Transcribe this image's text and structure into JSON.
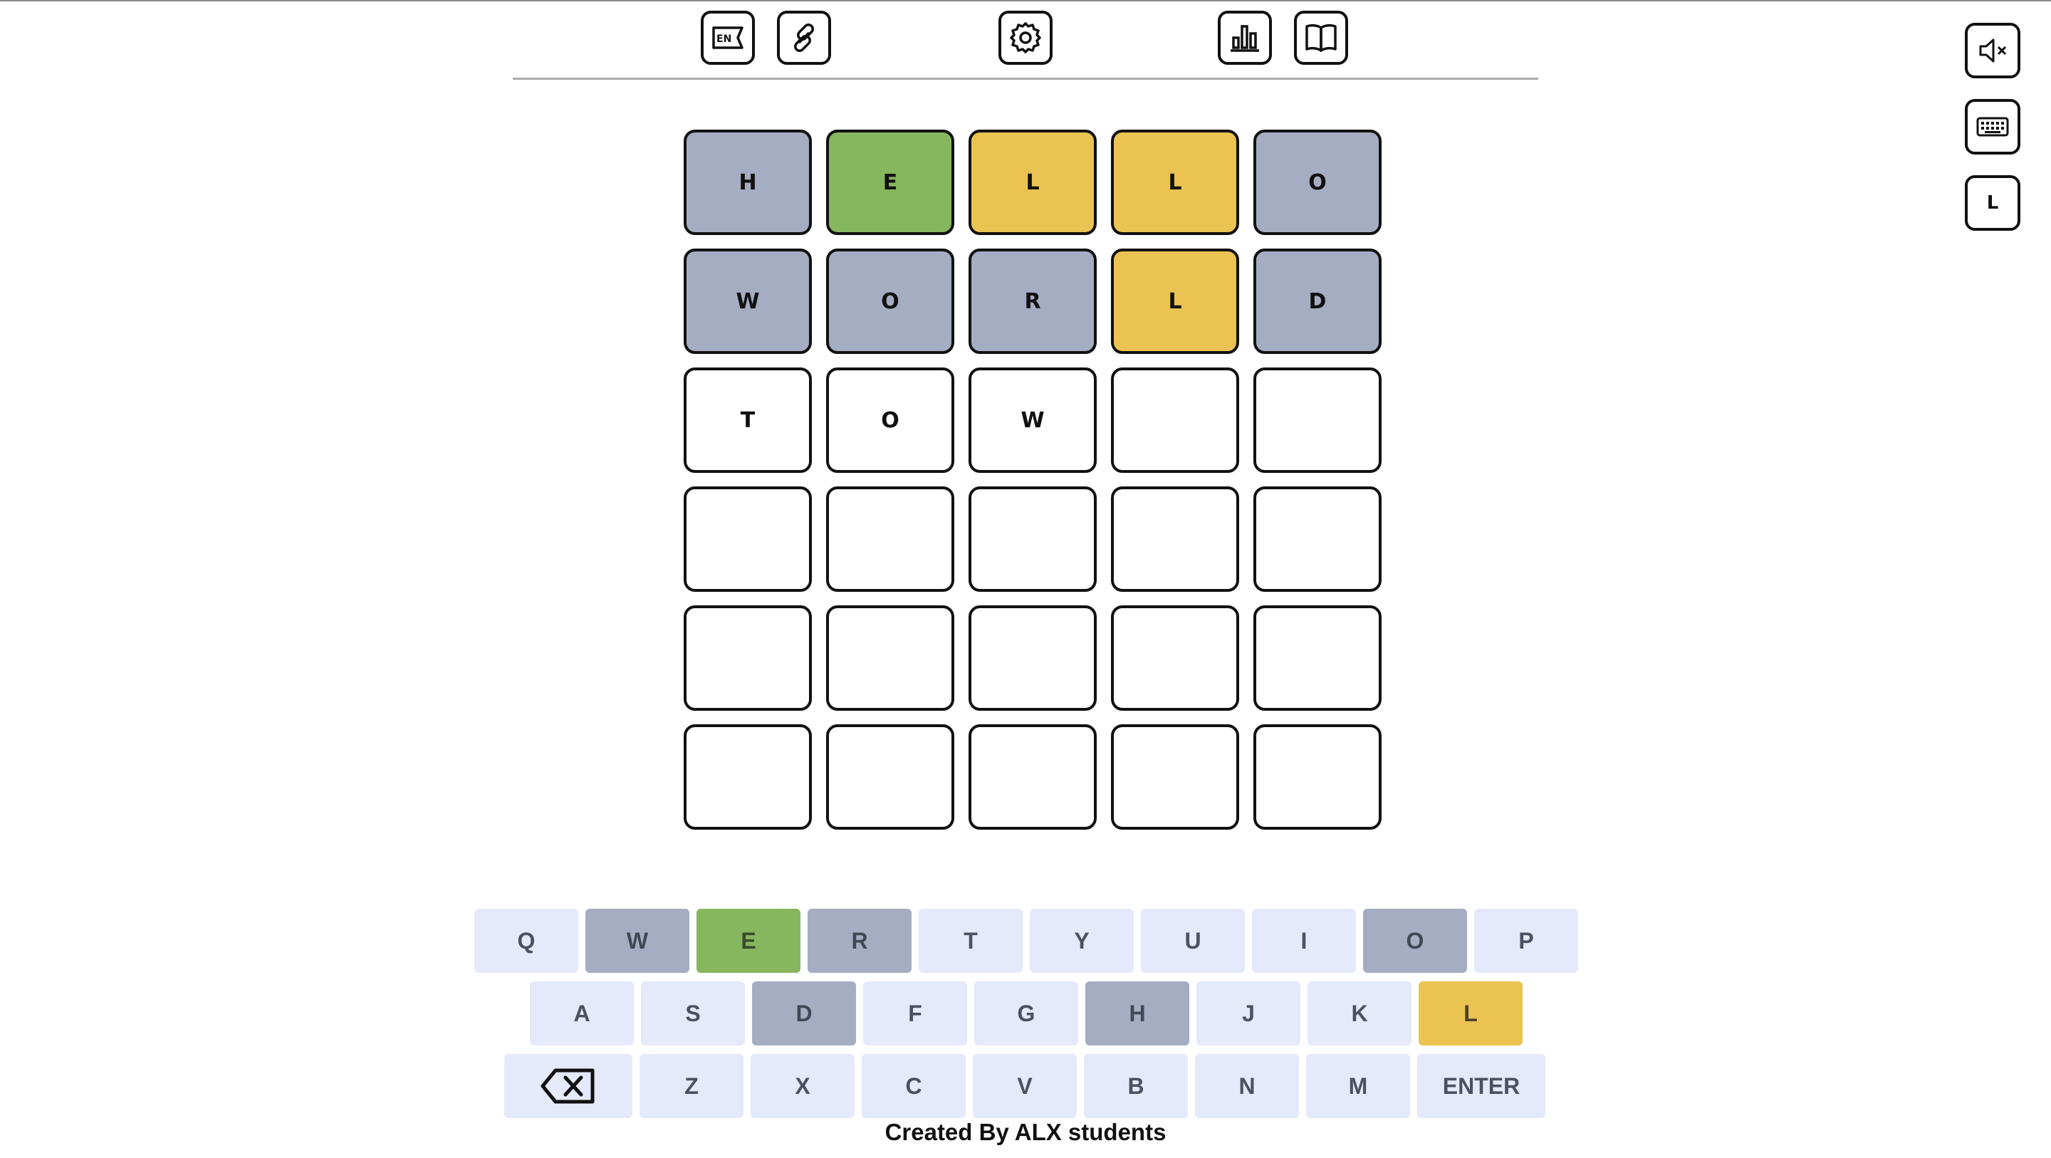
{
  "toolbar": {
    "language_label": "EN",
    "icons": [
      "language-flag-icon",
      "link-icon",
      "settings-gear-icon",
      "statistics-chart-icon",
      "book-icon"
    ]
  },
  "side_controls": {
    "mute_icon": "speaker-muted-icon",
    "keyboard_icon": "keyboard-icon",
    "letter_label": "L"
  },
  "board": {
    "rows": [
      [
        {
          "letter": "H",
          "state": "absent"
        },
        {
          "letter": "E",
          "state": "correct"
        },
        {
          "letter": "L",
          "state": "present"
        },
        {
          "letter": "L",
          "state": "present"
        },
        {
          "letter": "O",
          "state": "absent"
        }
      ],
      [
        {
          "letter": "W",
          "state": "absent"
        },
        {
          "letter": "O",
          "state": "absent"
        },
        {
          "letter": "R",
          "state": "absent"
        },
        {
          "letter": "L",
          "state": "present"
        },
        {
          "letter": "D",
          "state": "absent"
        }
      ],
      [
        {
          "letter": "T",
          "state": "typed"
        },
        {
          "letter": "O",
          "state": "typed"
        },
        {
          "letter": "W",
          "state": "typed"
        },
        {
          "letter": "",
          "state": "empty"
        },
        {
          "letter": "",
          "state": "empty"
        }
      ],
      [
        {
          "letter": "",
          "state": "empty"
        },
        {
          "letter": "",
          "state": "empty"
        },
        {
          "letter": "",
          "state": "empty"
        },
        {
          "letter": "",
          "state": "empty"
        },
        {
          "letter": "",
          "state": "empty"
        }
      ],
      [
        {
          "letter": "",
          "state": "empty"
        },
        {
          "letter": "",
          "state": "empty"
        },
        {
          "letter": "",
          "state": "empty"
        },
        {
          "letter": "",
          "state": "empty"
        },
        {
          "letter": "",
          "state": "empty"
        }
      ],
      [
        {
          "letter": "",
          "state": "empty"
        },
        {
          "letter": "",
          "state": "empty"
        },
        {
          "letter": "",
          "state": "empty"
        },
        {
          "letter": "",
          "state": "empty"
        },
        {
          "letter": "",
          "state": "empty"
        }
      ]
    ]
  },
  "keyboard": {
    "rows": [
      [
        {
          "label": "Q",
          "state": "unused"
        },
        {
          "label": "W",
          "state": "absent"
        },
        {
          "label": "E",
          "state": "correct"
        },
        {
          "label": "R",
          "state": "absent"
        },
        {
          "label": "T",
          "state": "unused"
        },
        {
          "label": "Y",
          "state": "unused"
        },
        {
          "label": "U",
          "state": "unused"
        },
        {
          "label": "I",
          "state": "unused"
        },
        {
          "label": "O",
          "state": "absent"
        },
        {
          "label": "P",
          "state": "unused"
        }
      ],
      [
        {
          "label": "A",
          "state": "unused"
        },
        {
          "label": "S",
          "state": "unused"
        },
        {
          "label": "D",
          "state": "absent"
        },
        {
          "label": "F",
          "state": "unused"
        },
        {
          "label": "G",
          "state": "unused"
        },
        {
          "label": "H",
          "state": "absent"
        },
        {
          "label": "J",
          "state": "unused"
        },
        {
          "label": "K",
          "state": "unused"
        },
        {
          "label": "L",
          "state": "present"
        }
      ],
      [
        {
          "label": "",
          "icon": "backspace-icon",
          "state": "unused"
        },
        {
          "label": "Z",
          "state": "unused"
        },
        {
          "label": "X",
          "state": "unused"
        },
        {
          "label": "C",
          "state": "unused"
        },
        {
          "label": "V",
          "state": "unused"
        },
        {
          "label": "B",
          "state": "unused"
        },
        {
          "label": "N",
          "state": "unused"
        },
        {
          "label": "M",
          "state": "unused"
        },
        {
          "label": "ENTER",
          "state": "unused"
        }
      ]
    ]
  },
  "footer": {
    "text": "Created By ALX students"
  },
  "colors": {
    "absent": "#a4adc2",
    "correct": "#86b65e",
    "present": "#ebc352",
    "key_default": "#e4e9fb"
  }
}
